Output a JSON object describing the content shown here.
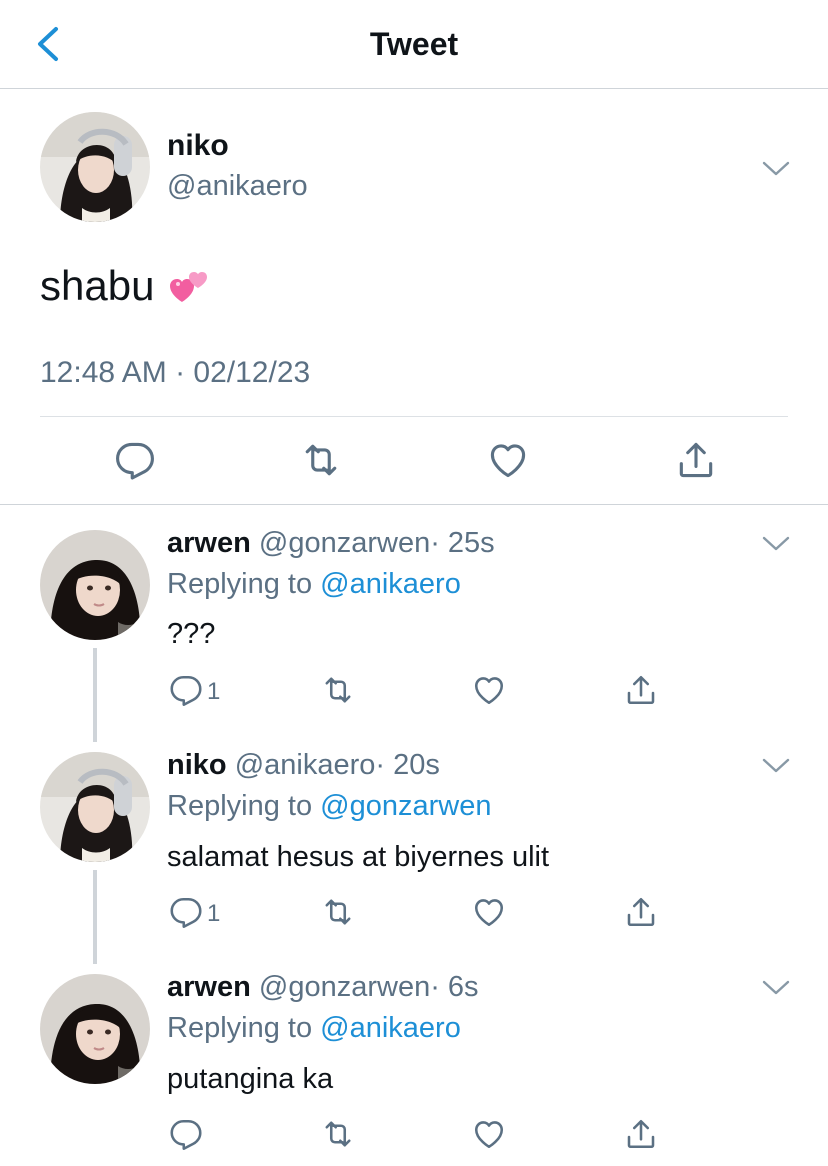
{
  "header": {
    "title": "Tweet"
  },
  "main_tweet": {
    "name": "niko",
    "handle": "@anikaero",
    "text": "shabu",
    "emoji_icon": "two-hearts-emoji",
    "timestamp": "12:48 AM · 02/12/23"
  },
  "replies": [
    {
      "name": "arwen",
      "handle": "@gonzarwen",
      "time": "· 25s",
      "replying_label": "Replying to",
      "replying_to": "@anikaero",
      "text": "???",
      "reply_count": "1"
    },
    {
      "name": "niko",
      "handle": "@anikaero",
      "time": "· 20s",
      "replying_label": "Replying to",
      "replying_to": "@gonzarwen",
      "text": "salamat hesus at biyernes ulit",
      "reply_count": "1"
    },
    {
      "name": "arwen",
      "handle": "@gonzarwen",
      "time": "· 6s",
      "replying_label": "Replying to",
      "replying_to": "@anikaero",
      "text": "putangina ka",
      "reply_count": ""
    }
  ],
  "colors": {
    "accent": "#1d8fd6",
    "secondary_text": "#5b7083",
    "primary_text": "#0f1419",
    "border": "#cfd4d9"
  }
}
